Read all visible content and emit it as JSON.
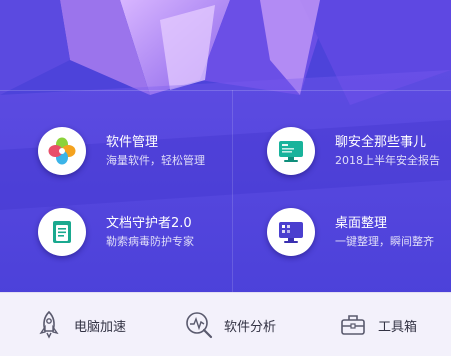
{
  "tiles": [
    {
      "title": "软件管理",
      "subtitle": "海量软件，轻松管理",
      "icon": "pinwheel-icon"
    },
    {
      "title": "聊安全那些事儿",
      "subtitle": "2018上半年安全报告",
      "icon": "monitor-report-icon"
    },
    {
      "title": "文档守护者2.0",
      "subtitle": "勒索病毒防护专家",
      "icon": "document-icon"
    },
    {
      "title": "桌面整理",
      "subtitle": "一键整理，瞬间整齐",
      "icon": "desktop-icon"
    }
  ],
  "bottom_bar": {
    "items": [
      {
        "label": "电脑加速",
        "icon": "rocket-icon"
      },
      {
        "label": "软件分析",
        "icon": "magnifier-chart-icon"
      },
      {
        "label": "工具箱",
        "icon": "toolbox-icon"
      }
    ]
  },
  "colors": {
    "hero_bg": "#4a3fd6",
    "accent_teal": "#1bb59a",
    "bottom_bg": "#f3f1fb"
  }
}
